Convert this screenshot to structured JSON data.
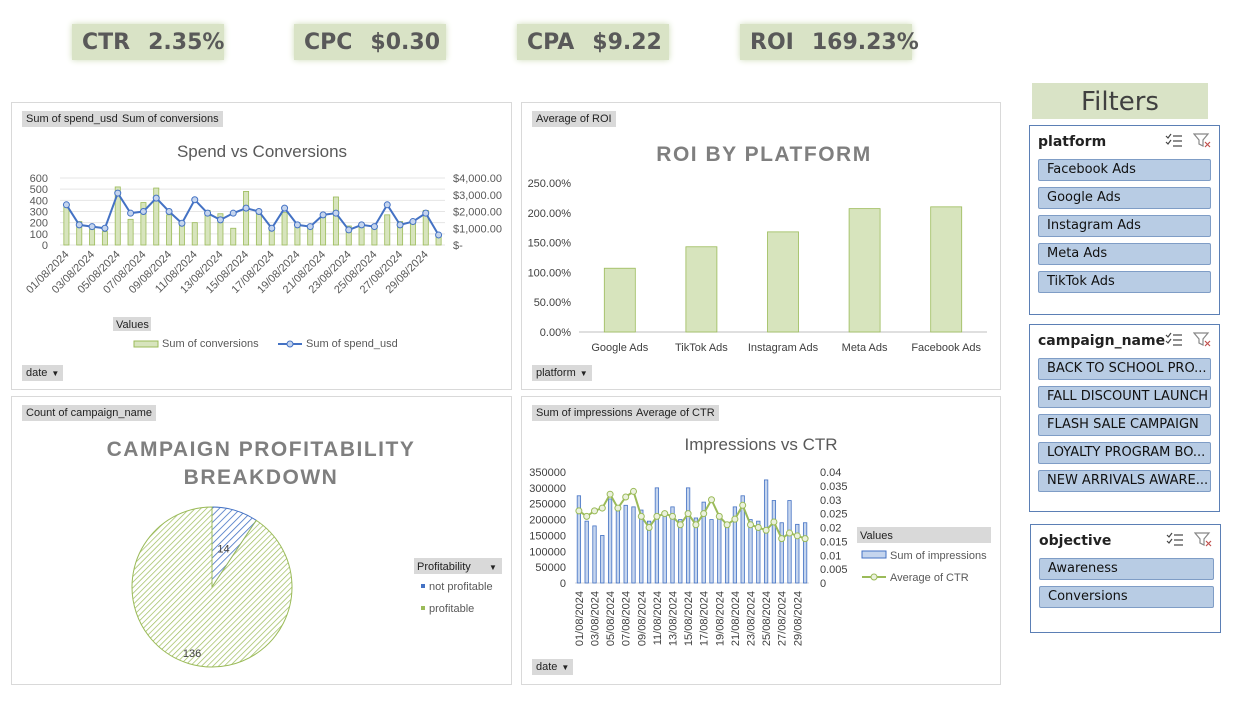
{
  "kpis": [
    {
      "label": "CTR",
      "value": "2.35%"
    },
    {
      "label": "CPC",
      "value": "$0.30"
    },
    {
      "label": "CPA",
      "value": "$9.22"
    },
    {
      "label": "ROI",
      "value": "169.23%"
    }
  ],
  "colors": {
    "green": "#9bbb59",
    "greenFill": "#d7e4bd",
    "blue": "#4472c4",
    "blueFill": "#c5d5ee",
    "kpiBg": "#d9e3c6",
    "slicerItem": "#b8cce4"
  },
  "charts": {
    "spend_conv": {
      "field_buttons": [
        "Sum of spend_usd",
        "Sum of conversions"
      ],
      "values_label": "Values",
      "axis_button": "date",
      "chart_data": {
        "type": "bar",
        "title": "Spend vs Conversions",
        "x": [
          "01/08/2024",
          "02/08/2024",
          "03/08/2024",
          "04/08/2024",
          "05/08/2024",
          "06/08/2024",
          "07/08/2024",
          "08/08/2024",
          "09/08/2024",
          "10/08/2024",
          "11/08/2024",
          "12/08/2024",
          "13/08/2024",
          "14/08/2024",
          "15/08/2024",
          "16/08/2024",
          "17/08/2024",
          "18/08/2024",
          "19/08/2024",
          "20/08/2024",
          "21/08/2024",
          "22/08/2024",
          "23/08/2024",
          "24/08/2024",
          "25/08/2024",
          "26/08/2024",
          "27/08/2024",
          "28/08/2024",
          "29/08/2024",
          "30/08/2024"
        ],
        "x_tick_labels": [
          "01/08/2024",
          "03/08/2024",
          "05/08/2024",
          "07/08/2024",
          "09/08/2024",
          "11/08/2024",
          "13/08/2024",
          "15/08/2024",
          "17/08/2024",
          "19/08/2024",
          "21/08/2024",
          "23/08/2024",
          "25/08/2024",
          "27/08/2024",
          "29/08/2024"
        ],
        "series": [
          {
            "name": "Sum of conversions",
            "type": "bar",
            "axis": "left",
            "values": [
              360,
              210,
              140,
              120,
              520,
              230,
              380,
              510,
              270,
              200,
              200,
              310,
              280,
              150,
              480,
              280,
              140,
              290,
              200,
              170,
              260,
              430,
              170,
              190,
              170,
              270,
              210,
              190,
              310,
              90
            ]
          },
          {
            "name": "Sum of spend_usd",
            "type": "line",
            "axis": "right",
            "values": [
              2400,
              1200,
              1100,
              1000,
              3100,
              1900,
              2000,
              2800,
              2000,
              1300,
              2700,
              1900,
              1500,
              1900,
              2200,
              2000,
              1000,
              2200,
              1200,
              1100,
              1800,
              1900,
              900,
              1200,
              1100,
              2400,
              1200,
              1400,
              1900,
              600
            ]
          }
        ],
        "ylim": [
          0,
          600
        ],
        "yticks": [
          "600",
          "500",
          "400",
          "300",
          "200",
          "100",
          "0"
        ],
        "y2lim": [
          0,
          4000
        ],
        "y2ticks": [
          "$4,000.00",
          "$3,000.00",
          "$2,000.00",
          "$1,000.00",
          "$-"
        ],
        "legend": "bottom"
      }
    },
    "roi_platform": {
      "field_buttons": [
        "Average of ROI"
      ],
      "axis_button": "platform",
      "chart_data": {
        "type": "bar",
        "title": "ROI BY PLATFORM",
        "categories": [
          "Google Ads",
          "TikTok Ads",
          "Instagram Ads",
          "Meta Ads",
          "Facebook Ads"
        ],
        "values": [
          107,
          143,
          168,
          207,
          210
        ],
        "ylim": [
          0,
          250
        ],
        "yticks": [
          "250.00%",
          "200.00%",
          "150.00%",
          "100.00%",
          "50.00%",
          "0.00%"
        ]
      }
    },
    "profitability": {
      "field_buttons": [
        "Count of campaign_name"
      ],
      "legend_title": "Profitability",
      "chart_data": {
        "type": "pie",
        "title_line1": "CAMPAIGN PROFITABILITY",
        "title_line2": "BREAKDOWN",
        "categories": [
          "not profitable",
          "profitable"
        ],
        "values": [
          14,
          136
        ],
        "data_labels": [
          "14",
          "136"
        ],
        "legend": "right"
      }
    },
    "impr_ctr": {
      "field_buttons": [
        "Sum of impressions",
        "Average of CTR"
      ],
      "values_label": "Values",
      "axis_button": "date",
      "chart_data": {
        "type": "bar",
        "title": "Impressions vs CTR",
        "x": [
          "01/08/2024",
          "02/08/2024",
          "03/08/2024",
          "04/08/2024",
          "05/08/2024",
          "06/08/2024",
          "07/08/2024",
          "08/08/2024",
          "09/08/2024",
          "10/08/2024",
          "11/08/2024",
          "12/08/2024",
          "13/08/2024",
          "14/08/2024",
          "15/08/2024",
          "16/08/2024",
          "17/08/2024",
          "18/08/2024",
          "19/08/2024",
          "20/08/2024",
          "21/08/2024",
          "22/08/2024",
          "23/08/2024",
          "24/08/2024",
          "25/08/2024",
          "26/08/2024",
          "27/08/2024",
          "28/08/2024",
          "29/08/2024",
          "30/08/2024"
        ],
        "x_tick_labels": [
          "01/08/2024",
          "03/08/2024",
          "05/08/2024",
          "07/08/2024",
          "09/08/2024",
          "11/08/2024",
          "13/08/2024",
          "15/08/2024",
          "17/08/2024",
          "19/08/2024",
          "21/08/2024",
          "23/08/2024",
          "25/08/2024",
          "27/08/2024",
          "29/08/2024"
        ],
        "series": [
          {
            "name": "Sum of impressions",
            "type": "bar",
            "axis": "left",
            "values": [
              275000,
              195000,
              180000,
              150000,
              265000,
              240000,
              245000,
              240000,
              230000,
              195000,
              300000,
              215000,
              240000,
              200000,
              300000,
              205000,
              255000,
              200000,
              205000,
              175000,
              240000,
              275000,
              200000,
              195000,
              325000,
              260000,
              190000,
              260000,
              185000,
              190000
            ]
          },
          {
            "name": "Average of CTR",
            "type": "line",
            "axis": "right",
            "values": [
              0.026,
              0.024,
              0.026,
              0.027,
              0.032,
              0.027,
              0.031,
              0.033,
              0.024,
              0.02,
              0.024,
              0.025,
              0.024,
              0.021,
              0.025,
              0.021,
              0.025,
              0.03,
              0.024,
              0.021,
              0.023,
              0.028,
              0.021,
              0.02,
              0.019,
              0.022,
              0.016,
              0.018,
              0.017,
              0.016
            ]
          }
        ],
        "ylim": [
          0,
          350000
        ],
        "yticks": [
          "350000",
          "300000",
          "250000",
          "200000",
          "150000",
          "100000",
          "50000",
          "0"
        ],
        "y2lim": [
          0,
          0.04
        ],
        "y2ticks": [
          "0.04",
          "0.035",
          "0.03",
          "0.025",
          "0.02",
          "0.015",
          "0.01",
          "0.005",
          "0"
        ],
        "legend": "right"
      }
    }
  },
  "filters": {
    "heading": "Filters",
    "slicers": [
      {
        "title": "platform",
        "items": [
          "Facebook Ads",
          "Google Ads",
          "Instagram Ads",
          "Meta Ads",
          "TikTok Ads"
        ]
      },
      {
        "title": "campaign_name",
        "items": [
          "BACK TO SCHOOL PRO...",
          "FALL DISCOUNT LAUNCH",
          "FLASH SALE CAMPAIGN",
          "LOYALTY PROGRAM BO...",
          "NEW ARRIVALS AWARE..."
        ]
      },
      {
        "title": "objective",
        "items": [
          "Awareness",
          "Conversions"
        ]
      }
    ]
  }
}
